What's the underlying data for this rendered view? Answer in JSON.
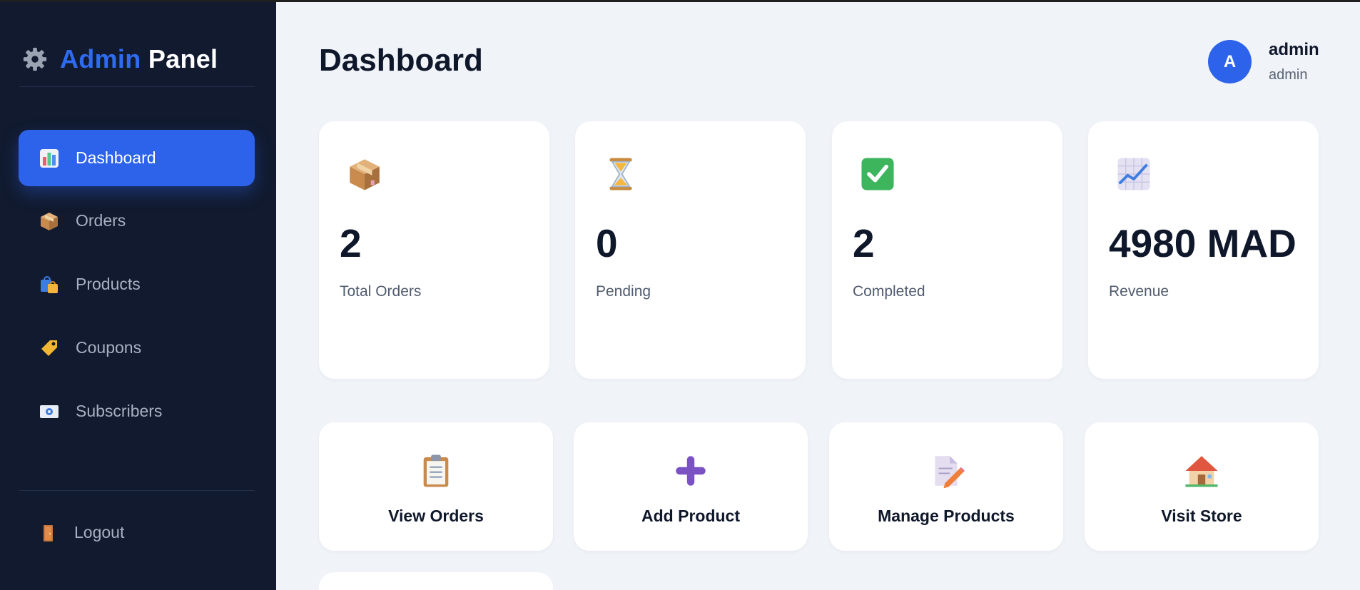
{
  "brand": {
    "word1": "Admin",
    "word2": "Panel",
    "icon": "gear-icon"
  },
  "sidebar": {
    "items": [
      {
        "label": "Dashboard",
        "icon": "bar-chart-icon",
        "active": true
      },
      {
        "label": "Orders",
        "icon": "package-icon"
      },
      {
        "label": "Products",
        "icon": "shopping-bags-icon"
      },
      {
        "label": "Coupons",
        "icon": "tag-icon"
      },
      {
        "label": "Subscribers",
        "icon": "envelope-icon"
      }
    ],
    "logout": {
      "label": "Logout",
      "icon": "door-icon"
    }
  },
  "header": {
    "title": "Dashboard"
  },
  "user": {
    "initial": "A",
    "name": "admin",
    "role": "admin"
  },
  "stats": [
    {
      "value": "2",
      "label": "Total Orders",
      "icon": "package-icon"
    },
    {
      "value": "0",
      "label": "Pending",
      "icon": "hourglass-icon"
    },
    {
      "value": "2",
      "label": "Completed",
      "icon": "check-icon"
    },
    {
      "value": "4980 MAD",
      "label": "Revenue",
      "icon": "trend-chart-icon"
    }
  ],
  "actions": [
    {
      "label": "View Orders",
      "icon": "clipboard-icon"
    },
    {
      "label": "Add Product",
      "icon": "plus-icon"
    },
    {
      "label": "Manage Products",
      "icon": "edit-document-icon"
    },
    {
      "label": "Visit Store",
      "icon": "house-icon"
    }
  ],
  "colors": {
    "sidebar_bg": "#111a2e",
    "accent": "#2d63ea",
    "page_bg": "#f0f3f8"
  }
}
